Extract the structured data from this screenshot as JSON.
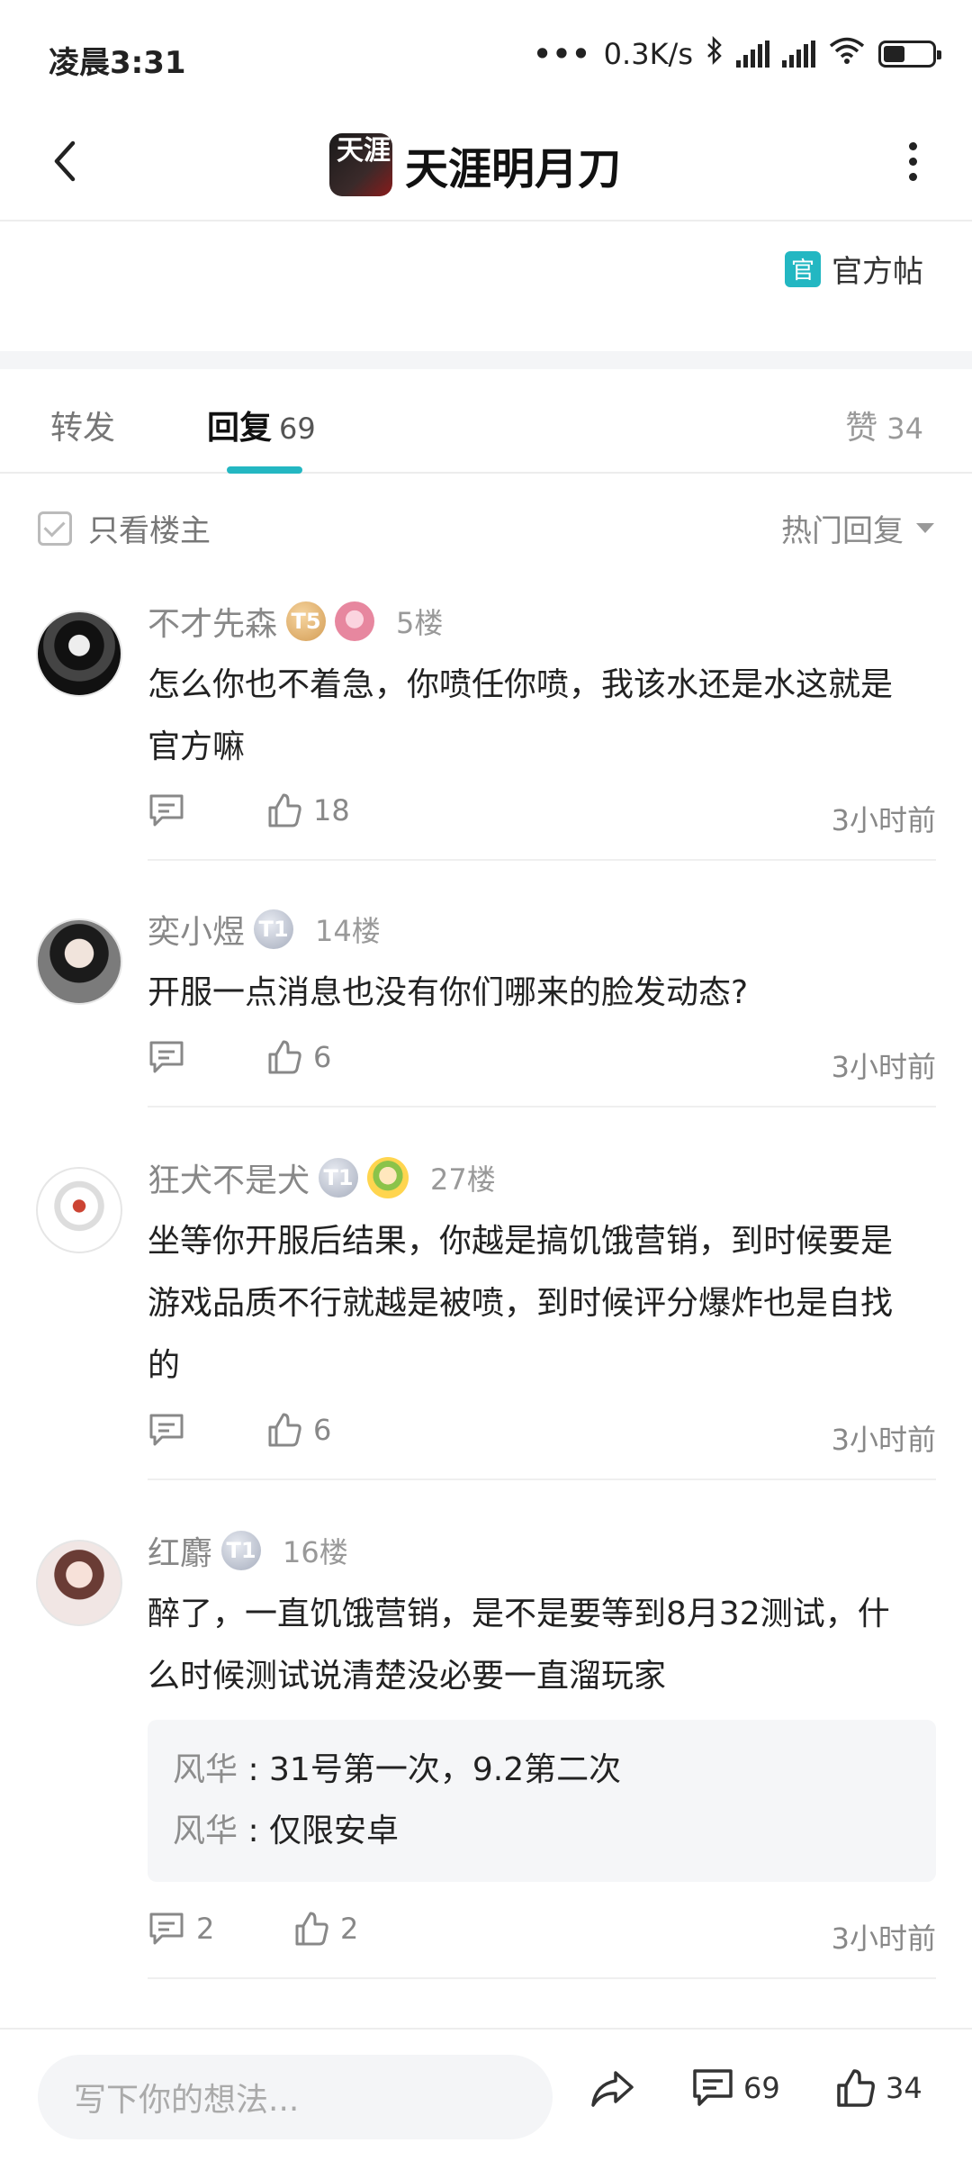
{
  "status_bar": {
    "time": "凌晨3:31",
    "net_speed": "0.3K/s"
  },
  "header": {
    "title": "天涯明月刀",
    "logo_text": "天涯"
  },
  "official": {
    "icon_text": "官",
    "label": "官方帖"
  },
  "tabs": {
    "forward": "转发",
    "reply": "回复",
    "reply_count": "69",
    "like": "赞",
    "like_count": "34"
  },
  "filter": {
    "only_owner": "只看楼主",
    "sort": "热门回复"
  },
  "comments": [
    {
      "user": "不才先森",
      "level_text": "T5",
      "floor": "5楼",
      "text": "怎么你也不着急，你喷任你喷，我该水还是水这就是官方嘛",
      "likes": "18",
      "time": "3小时前"
    },
    {
      "user": "奕小煜",
      "level_text": "T1",
      "floor": "14楼",
      "text": "开服一点消息也没有你们哪来的脸发动态?",
      "likes": "6",
      "time": "3小时前"
    },
    {
      "user": "狂犬不是犬",
      "level_text": "T1",
      "floor": "27楼",
      "text": "坐等你开服后结果，你越是搞饥饿营销，到时候要是游戏品质不行就越是被喷，到时候评分爆炸也是自找的",
      "likes": "6",
      "time": "3小时前"
    },
    {
      "user": "红麝",
      "level_text": "T1",
      "floor": "16楼",
      "text": "醉了，一直饥饿营销，是不是要等到8月32测试，什么时候测试说清楚没必要一直溜玩家",
      "replies": [
        {
          "name": "风华",
          "text": "31号第一次，9.2第二次"
        },
        {
          "name": "风华",
          "text": "仅限安卓"
        }
      ],
      "reply_count": "2",
      "likes": "2",
      "time": "3小时前"
    }
  ],
  "bottom_bar": {
    "input_placeholder": "写下你的想法...",
    "comment_count": "69",
    "like_count": "34"
  }
}
